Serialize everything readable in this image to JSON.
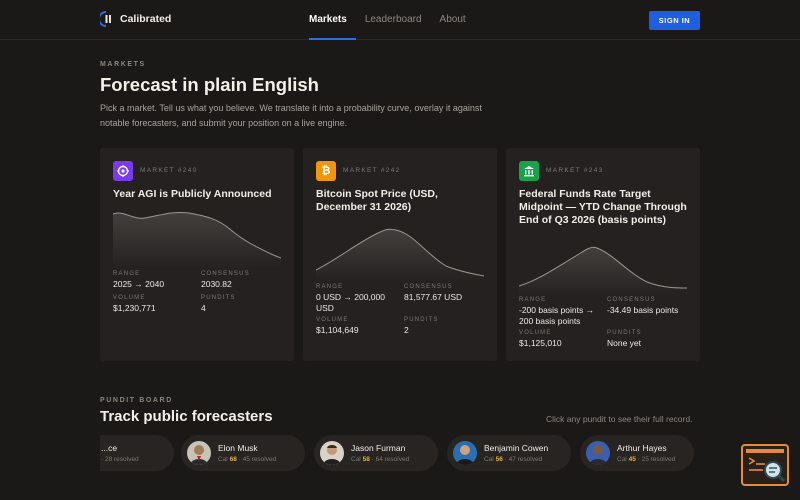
{
  "brand": {
    "name": "Calibrated",
    "accent": "#1e5fe0"
  },
  "nav": {
    "items": [
      {
        "label": "Markets",
        "active": true
      },
      {
        "label": "Leaderboard",
        "active": false
      },
      {
        "label": "About",
        "active": false
      }
    ],
    "sign_in_label": "SIGN IN"
  },
  "intro": {
    "eyebrow": "MARKETS",
    "title": "Forecast in plain English",
    "description": "Pick a market. Tell us what you believe. We translate it into a probability curve, overlay it against notable forecasters, and submit your position on a live engine."
  },
  "markets": [
    {
      "id_label": "MARKET #240",
      "title": "Year AGI is Publicly Announced",
      "icon": "target-icon",
      "icon_color": "#7c3aed",
      "range_label": "RANGE",
      "range": "2025 → 2040",
      "consensus_label": "CONSENSUS",
      "consensus": "2030.82",
      "volume_label": "VOLUME",
      "volume": "$1,230,771",
      "pundits_label": "PUNDITS",
      "pundits": "4"
    },
    {
      "id_label": "MARKET #242",
      "title": "Bitcoin Spot Price (USD, December 31 2026)",
      "icon": "bitcoin-icon",
      "icon_color": "#f2960d",
      "range_label": "RANGE",
      "range": "0 USD → 200,000 USD",
      "consensus_label": "CONSENSUS",
      "consensus": "81,577.67 USD",
      "volume_label": "VOLUME",
      "volume": "$1,104,649",
      "pundits_label": "PUNDITS",
      "pundits": "2"
    },
    {
      "id_label": "MARKET #243",
      "title": "Federal Funds Rate Target Midpoint — YTD Change Through End of Q3 2026 (basis points)",
      "icon": "bank-icon",
      "icon_color": "#16a34a",
      "range_label": "RANGE",
      "range": "-200 basis points → 200 basis points",
      "consensus_label": "CONSENSUS",
      "consensus": "-34.49 basis points",
      "volume_label": "VOLUME",
      "volume": "$1,125,010",
      "pundits_label": "PUNDITS",
      "pundits": "None yet"
    }
  ],
  "pundit_board": {
    "eyebrow": "PUNDIT BOARD",
    "title": "Track public forecasters",
    "hint": "Click any pundit to see their full record.",
    "cal_prefix": "Cal",
    "pundits": [
      {
        "name": "...ce",
        "cal": "",
        "resolved": "· 28 resolved"
      },
      {
        "name": "Elon Musk",
        "cal": "68",
        "resolved": "· 45 resolved"
      },
      {
        "name": "Jason Furman",
        "cal": "58",
        "resolved": "· 64 resolved"
      },
      {
        "name": "Benjamin Cowen",
        "cal": "56",
        "resolved": "· 47 resolved"
      },
      {
        "name": "Arthur Hayes",
        "cal": "45",
        "resolved": "· 25 resolved"
      }
    ]
  }
}
